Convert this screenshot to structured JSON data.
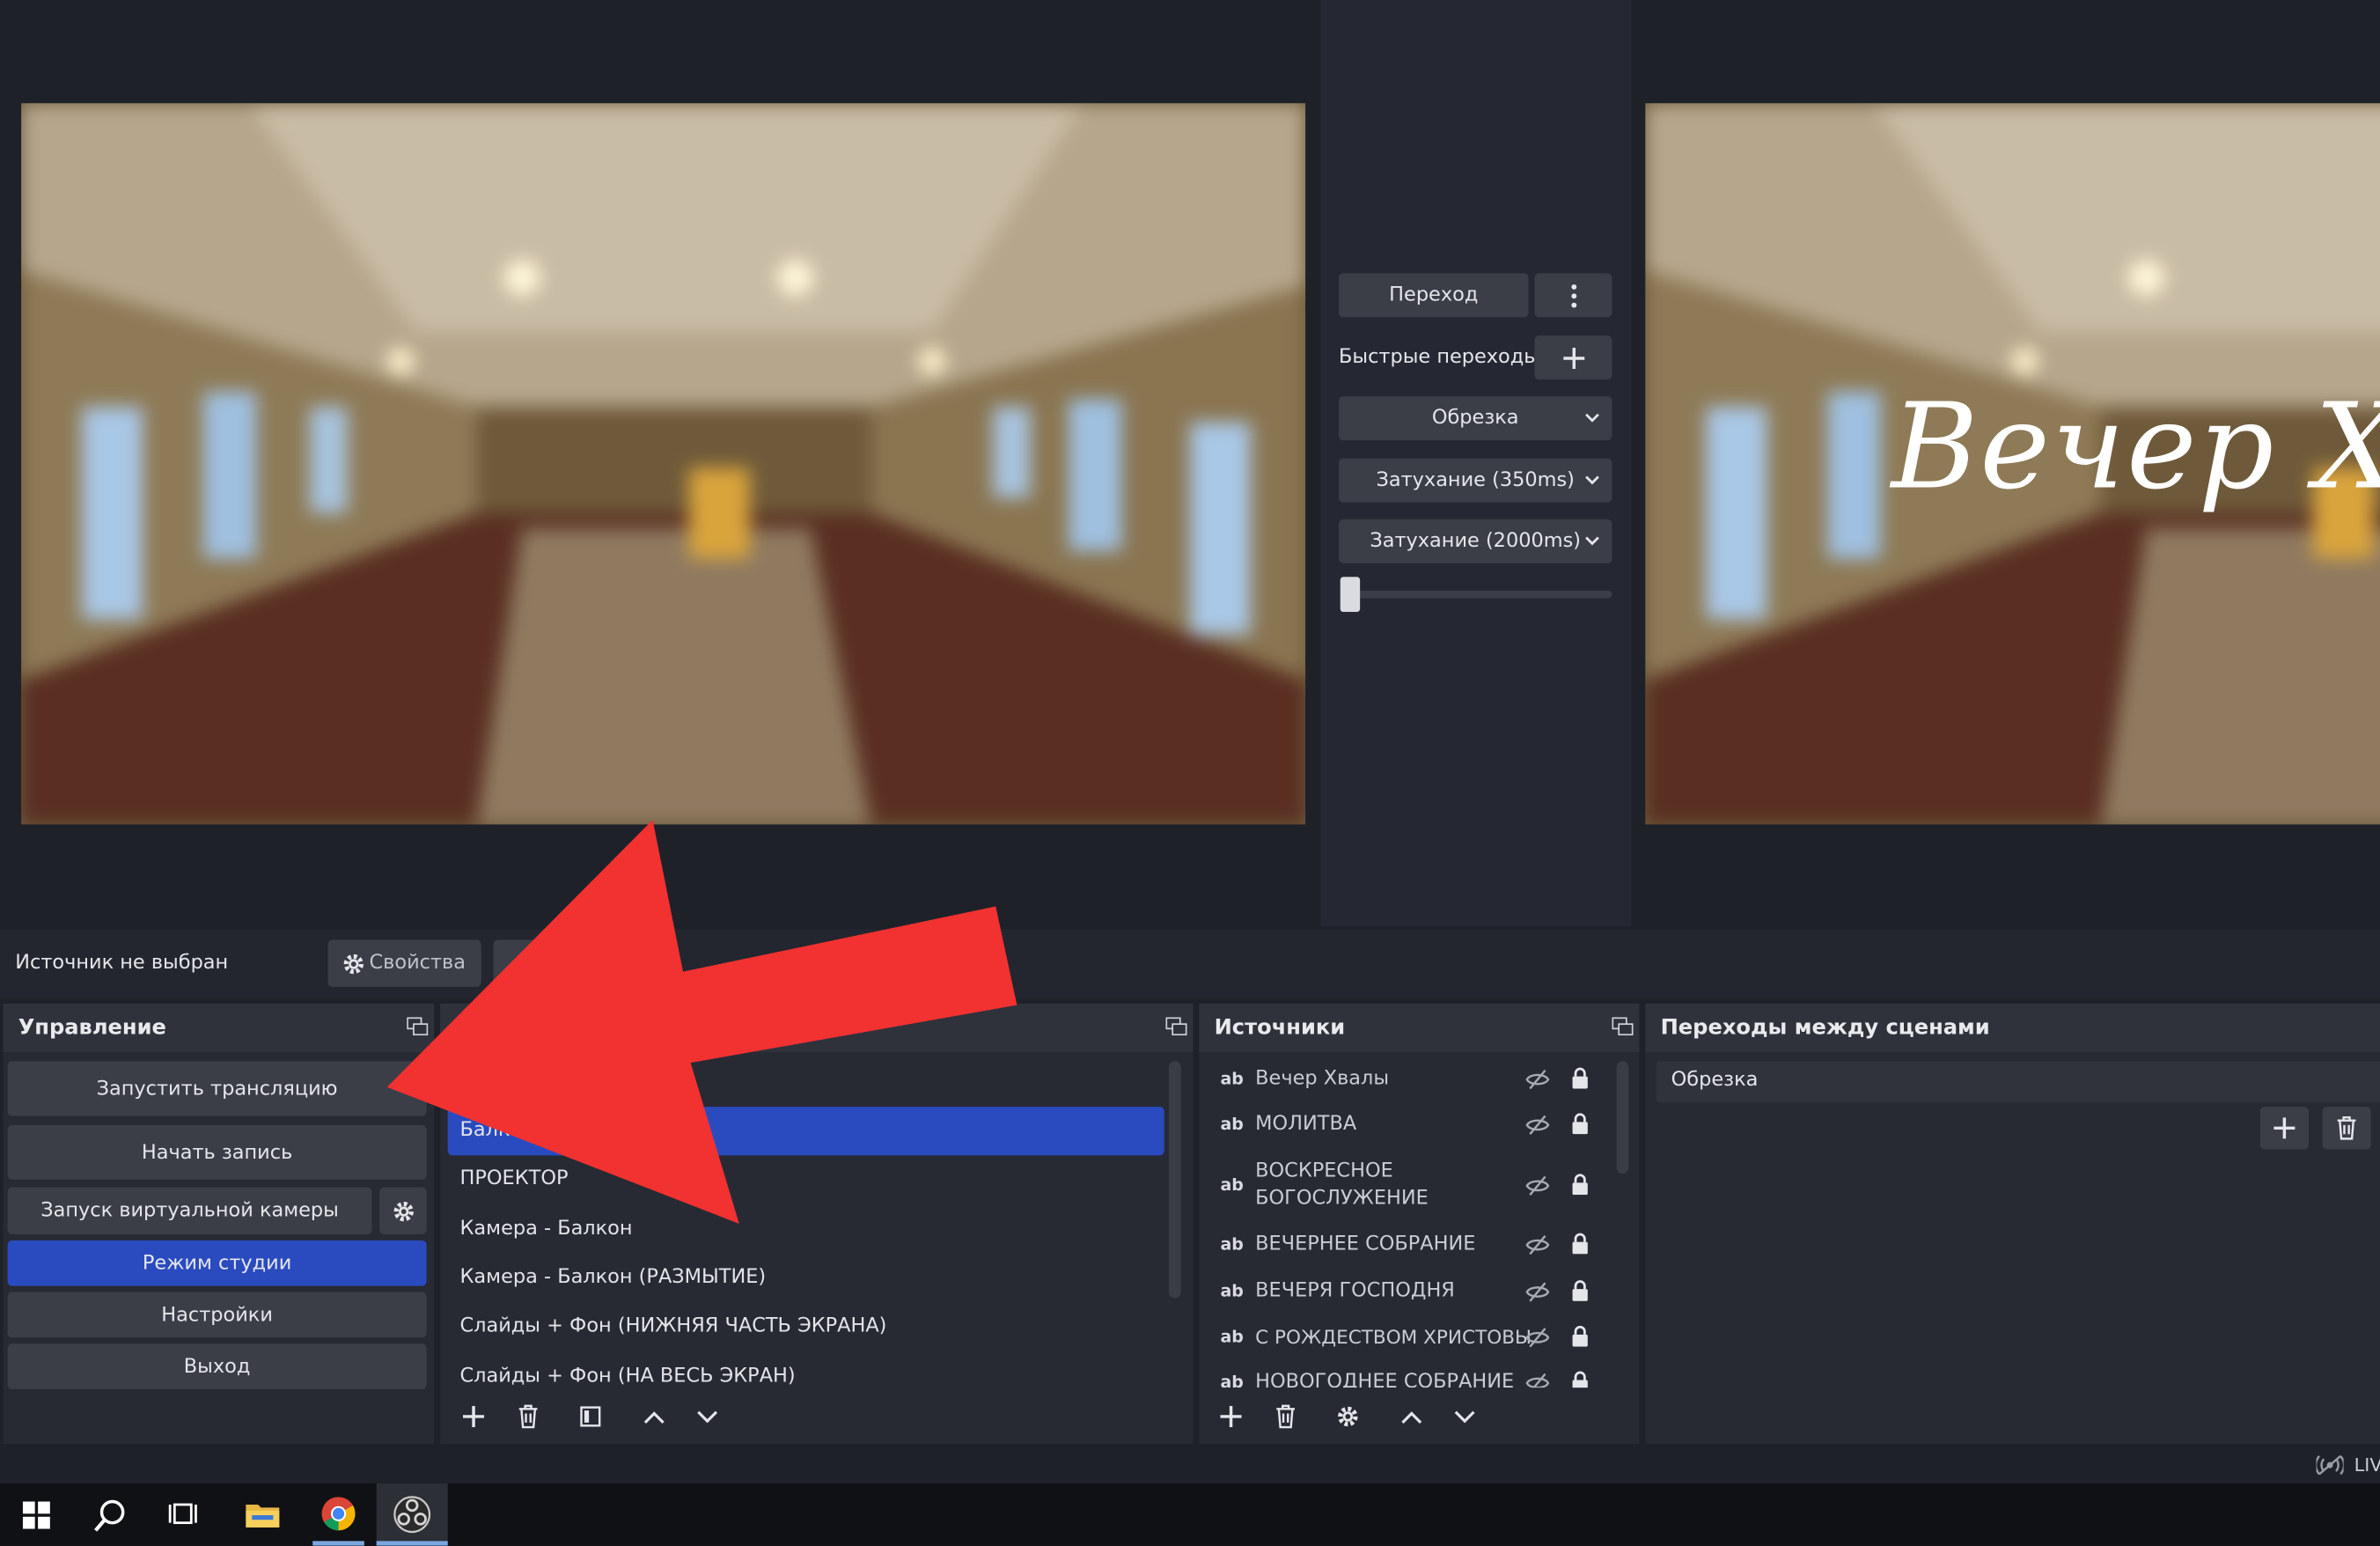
{
  "transition_panel": {
    "transition_label": "Переход",
    "quick_transitions_label": "Быстрые переходы",
    "selected_transition": "Обрезка",
    "fade_350": "Затухание (350ms)",
    "fade_2000": "Затухание (2000ms)",
    "tbar_value": 0
  },
  "program_overlay_text": "Вечер Х",
  "status_bar": {
    "source_status": "Источник не выбран",
    "properties_label": "Свойства"
  },
  "controls": {
    "title": "Управление",
    "start_stream": "Запустить трансляцию",
    "start_recording": "Начать запись",
    "start_virtual_camera": "Запуск виртуальной камеры",
    "studio_mode": "Режим студии",
    "settings": "Настройки",
    "exit": "Выход"
  },
  "scenes": {
    "items": [
      "Балко",
      "ПРОЕКТОР",
      "Камера - Балкон",
      "Камера - Балкон (РАЗМЫТИЕ)",
      "Слайды + Фон (НИЖНЯЯ ЧАСТЬ ЭКРАНА)",
      "Слайды + Фон (НА ВЕСЬ ЭКРАН)"
    ]
  },
  "sources": {
    "title": "Источники",
    "type_label": "ab",
    "items": [
      "Вечер Хвалы",
      "МОЛИТВА",
      "ВОСКРЕСНОЕ",
      "БОГОСЛУЖЕНИЕ",
      "ВЕЧЕРНЕЕ СОБРАНИЕ",
      "ВЕЧЕРЯ ГОСПОДНЯ",
      "С РОЖДЕСТВОМ ХРИСТОВЫ",
      "НОВОГОДНЕЕ СОБРАНИЕ"
    ]
  },
  "scene_transitions": {
    "title": "Переходы между сценами",
    "selected": "Обрезка"
  },
  "footer": {
    "live_label": "LIV"
  },
  "colors": {
    "accent_blue": "#2a4bbf",
    "arrow_red": "#f23131",
    "panel_bg": "#272a33",
    "window_bg": "#1f2129"
  },
  "icons": [
    "windows-start-icon",
    "search-icon",
    "task-view-icon",
    "file-explorer-icon",
    "chrome-icon",
    "obs-icon"
  ]
}
